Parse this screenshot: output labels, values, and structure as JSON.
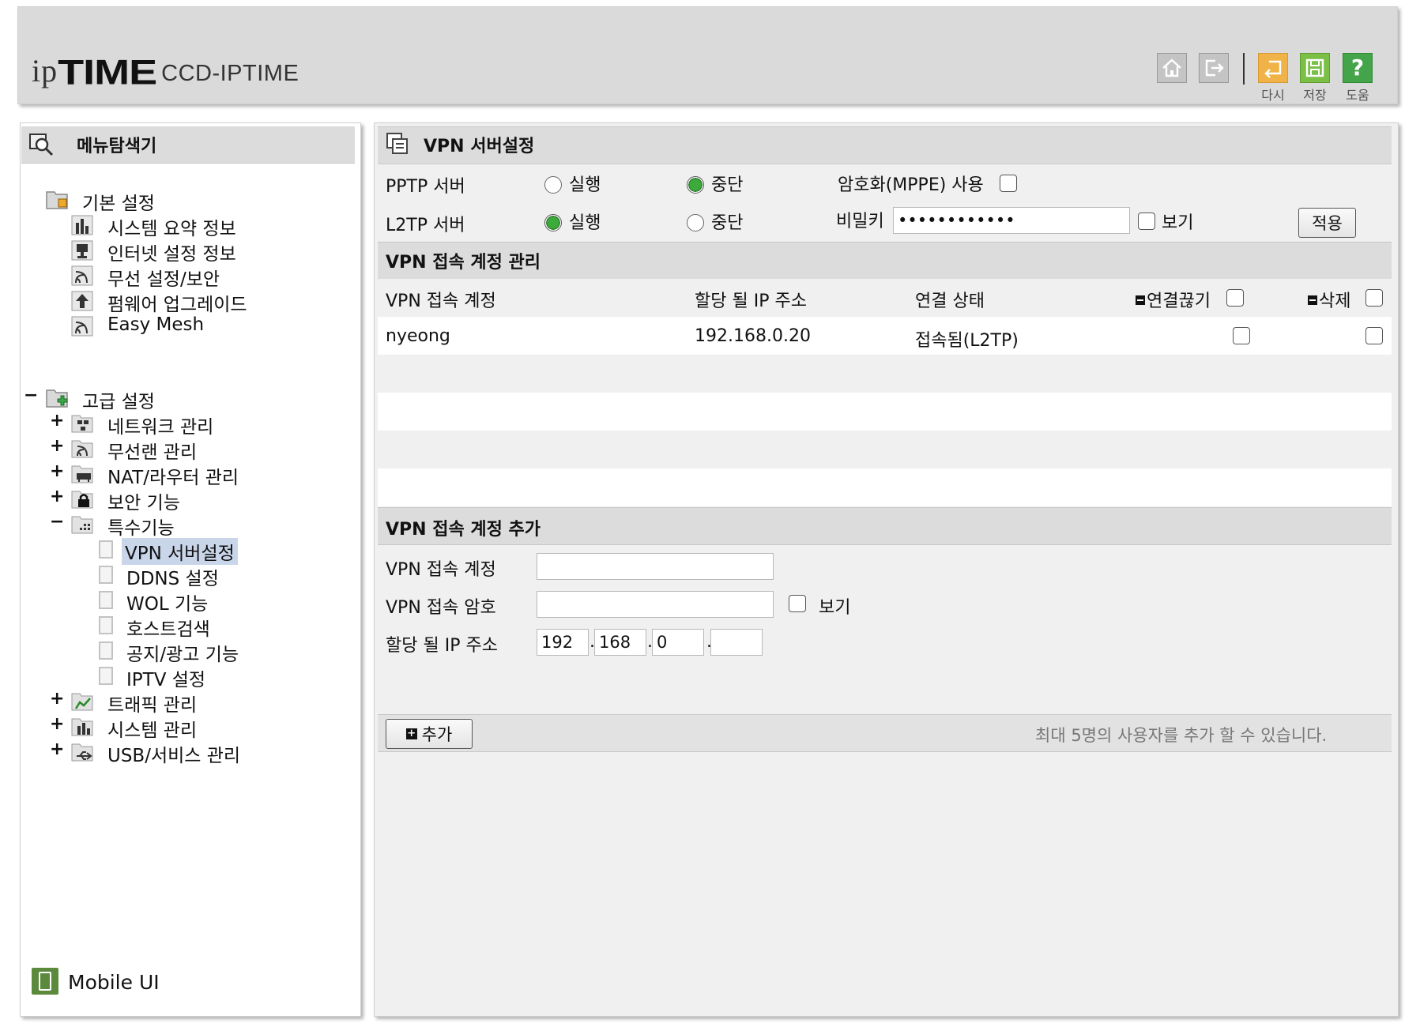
{
  "header": {
    "logo_ip": "ip",
    "logo_time": "TIME",
    "logo_model": "CCD-IPTIME",
    "buttons": [
      {
        "label": "",
        "icon": "home-icon"
      },
      {
        "label": "",
        "icon": "logout-icon"
      },
      {
        "label": "다시",
        "icon": "undo-icon"
      },
      {
        "label": "저장",
        "icon": "save-icon"
      },
      {
        "label": "도움",
        "icon": "help-icon"
      }
    ]
  },
  "menu": {
    "title": "메뉴탐색기",
    "basic": {
      "label": "기본 설정",
      "items": [
        "시스템 요약 정보",
        "인터넷 설정 정보",
        "무선 설정/보안",
        "펌웨어 업그레이드",
        "Easy Mesh"
      ]
    },
    "advanced": {
      "toggle": "−",
      "label": "고급 설정",
      "groups": [
        {
          "toggle": "+",
          "label": "네트워크 관리"
        },
        {
          "toggle": "+",
          "label": "무선랜 관리"
        },
        {
          "toggle": "+",
          "label": "NAT/라우터 관리"
        },
        {
          "toggle": "+",
          "label": "보안 기능"
        },
        {
          "toggle": "−",
          "label": "특수기능"
        }
      ],
      "special_items": [
        "VPN 서버설정",
        "DDNS 설정",
        "WOL 기능",
        "호스트검색",
        "공지/광고 기능",
        "IPTV 설정"
      ],
      "groups_after": [
        {
          "toggle": "+",
          "label": "트래픽 관리"
        },
        {
          "toggle": "+",
          "label": "시스템 관리"
        },
        {
          "toggle": "+",
          "label": "USB/서비스 관리"
        }
      ]
    },
    "mobile_ui": "Mobile UI"
  },
  "vpn": {
    "title": "VPN 서버설정",
    "pptp": {
      "label": "PPTP 서버",
      "run": "실행",
      "stop": "중단",
      "selected": "stop"
    },
    "l2tp": {
      "label": "L2TP 서버",
      "run": "실행",
      "stop": "중단",
      "selected": "run"
    },
    "mppe_label": "암호화(MPPE) 사용",
    "secret_label": "비밀키",
    "secret_value": "••••••••••••",
    "show_label": "보기",
    "apply_label": "적용"
  },
  "accounts": {
    "title": "VPN 접속 계정 관리",
    "columns": [
      "VPN 접속 계정",
      "할당 될 IP 주소",
      "연결 상태",
      "연결끊기",
      "삭제"
    ],
    "rows": [
      {
        "account": "nyeong",
        "ip": "192.168.0.20",
        "status": "접속됨(L2TP)"
      }
    ]
  },
  "add": {
    "title": "VPN 접속 계정 추가",
    "account_label": "VPN 접속 계정",
    "account_value": "",
    "password_label": "VPN 접속 암호",
    "password_value": "",
    "show_label": "보기",
    "ip_label": "할당 될 IP 주소",
    "ip_octets": [
      "192",
      "168",
      "0",
      ""
    ],
    "dot": ".",
    "add_button": "추가",
    "note": "최대 5명의 사용자를 추가 할 수 있습니다."
  }
}
